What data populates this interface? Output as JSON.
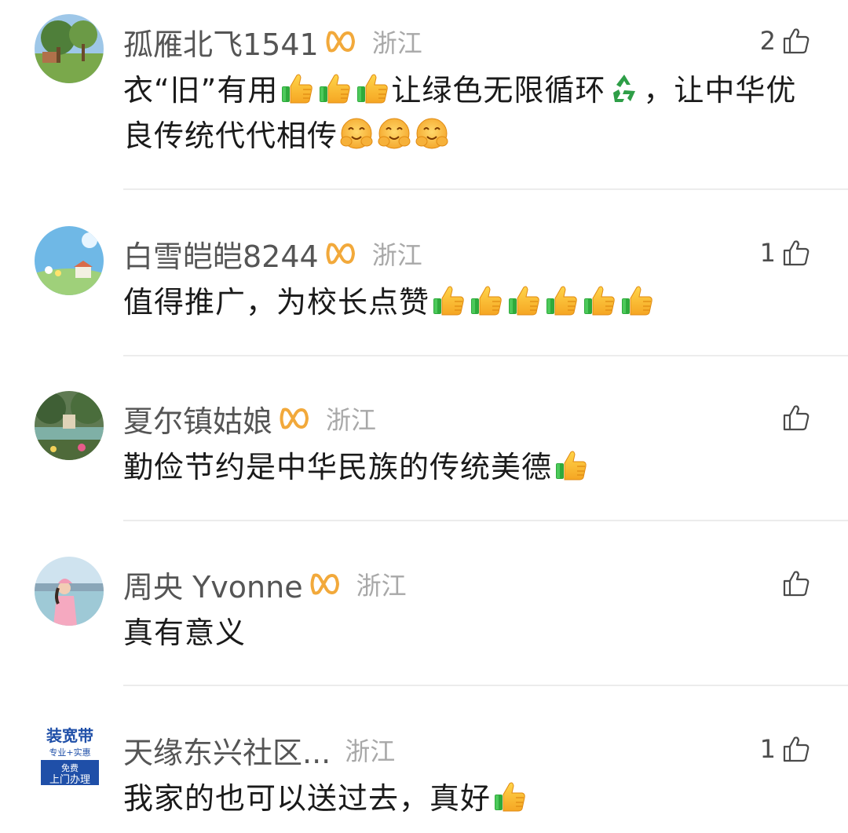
{
  "comments": [
    {
      "username": "孤雁北飞1541",
      "location": "浙江",
      "likes": "2",
      "avatar_icon": "tree-landscape-avatar",
      "text_parts": [
        "衣“旧”有用",
        "让绿色无限循环",
        "，让中华优良传统代代相传"
      ],
      "emojis": [
        "thumbs-up-icon",
        "recycle-icon",
        "hug-face-icon"
      ]
    },
    {
      "username": "白雪皑皑8244",
      "location": "浙江",
      "likes": "1",
      "avatar_icon": "sky-landscape-avatar",
      "text_parts": [
        "值得推广，为校长点赞"
      ],
      "emojis": [
        "thumbs-up-icon"
      ]
    },
    {
      "username": "夏尔镇姑娘",
      "location": "浙江",
      "likes": "",
      "avatar_icon": "lake-landscape-avatar",
      "text_parts": [
        "勤俭节约是中华民族的传统美德"
      ],
      "emojis": [
        "thumbs-up-icon"
      ]
    },
    {
      "username": "周央 Yvonne",
      "location": "浙江",
      "likes": "",
      "avatar_icon": "woman-seaside-avatar",
      "text_parts": [
        "真有意义"
      ],
      "emojis": []
    },
    {
      "username": "天缘东兴社区...",
      "location": "浙江",
      "likes": "1",
      "avatar_icon": "broadband-ad-avatar",
      "avatar_text": [
        "装宽带",
        "专业+实惠",
        "免费",
        "上门办理"
      ],
      "text_parts": [
        "我家的也可以送过去，真好"
      ],
      "emojis": [
        "thumbs-up-icon"
      ]
    }
  ],
  "colors": {
    "username": "#555555",
    "location": "#a8a8a8",
    "text": "#1a1a1a",
    "vip_gold": "#f2a93b",
    "divider": "#ececec"
  }
}
